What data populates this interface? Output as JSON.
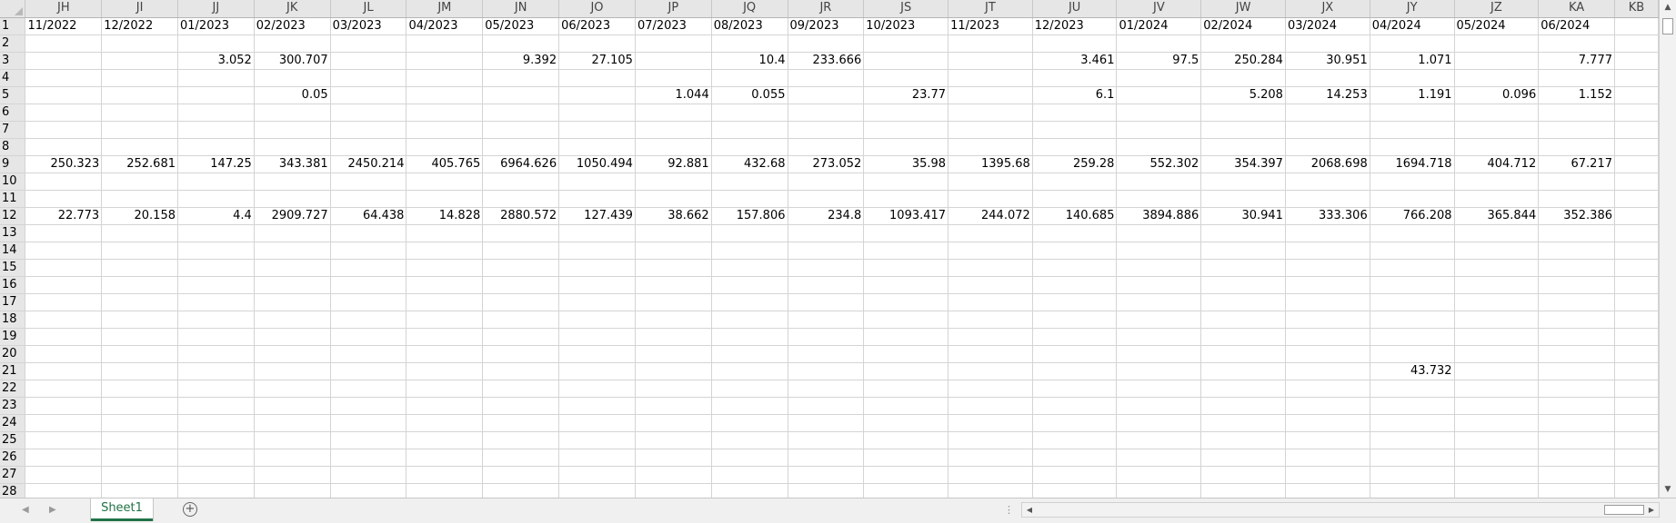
{
  "sheet": {
    "columns": [
      "JH",
      "JI",
      "JJ",
      "JK",
      "JL",
      "JM",
      "JN",
      "JO",
      "JP",
      "JQ",
      "JR",
      "JS",
      "JT",
      "JU",
      "JV",
      "JW",
      "JX",
      "JY",
      "JZ",
      "KA",
      "KB"
    ],
    "col_widths": [
      84,
      84,
      84,
      84,
      84,
      84,
      84,
      84,
      84,
      84,
      84,
      93,
      93,
      93,
      93,
      93,
      93,
      93,
      93,
      84,
      48
    ],
    "rows": [
      {
        "n": "1",
        "cells": [
          "11/2022",
          "12/2022",
          "01/2023",
          "02/2023",
          "03/2023",
          "04/2023",
          "05/2023",
          "06/2023",
          "07/2023",
          "08/2023",
          "09/2023",
          "10/2023",
          "11/2023",
          "12/2023",
          "01/2024",
          "02/2024",
          "03/2024",
          "04/2024",
          "05/2024",
          "06/2024",
          ""
        ]
      },
      {
        "n": "2",
        "cells": []
      },
      {
        "n": "3",
        "cells": [
          "",
          "",
          "3.052",
          "300.707",
          "",
          "",
          "9.392",
          "27.105",
          "",
          "10.4",
          "233.666",
          "",
          "",
          "3.461",
          "97.5",
          "250.284",
          "30.951",
          "1.071",
          "",
          "7.777",
          ""
        ]
      },
      {
        "n": "4",
        "cells": []
      },
      {
        "n": "5",
        "cells": [
          "",
          "",
          "",
          "0.05",
          "",
          "",
          "",
          "",
          "1.044",
          "0.055",
          "",
          "23.77",
          "",
          "6.1",
          "",
          "5.208",
          "14.253",
          "1.191",
          "0.096",
          "1.152",
          ""
        ]
      },
      {
        "n": "6",
        "cells": []
      },
      {
        "n": "7",
        "cells": []
      },
      {
        "n": "8",
        "cells": []
      },
      {
        "n": "9",
        "cells": [
          "250.323",
          "252.681",
          "147.25",
          "343.381",
          "2450.214",
          "405.765",
          "6964.626",
          "1050.494",
          "92.881",
          "432.68",
          "273.052",
          "35.98",
          "1395.68",
          "259.28",
          "552.302",
          "354.397",
          "2068.698",
          "1694.718",
          "404.712",
          "67.217",
          ""
        ]
      },
      {
        "n": "10",
        "cells": []
      },
      {
        "n": "11",
        "cells": []
      },
      {
        "n": "12",
        "cells": [
          "22.773",
          "20.158",
          "4.4",
          "2909.727",
          "64.438",
          "14.828",
          "2880.572",
          "127.439",
          "38.662",
          "157.806",
          "234.8",
          "1093.417",
          "244.072",
          "140.685",
          "3894.886",
          "30.941",
          "333.306",
          "766.208",
          "365.844",
          "352.386",
          ""
        ]
      },
      {
        "n": "13",
        "cells": []
      },
      {
        "n": "14",
        "cells": []
      },
      {
        "n": "15",
        "cells": []
      },
      {
        "n": "16",
        "cells": []
      },
      {
        "n": "17",
        "cells": []
      },
      {
        "n": "18",
        "cells": []
      },
      {
        "n": "19",
        "cells": []
      },
      {
        "n": "20",
        "cells": []
      },
      {
        "n": "21",
        "cells": [
          "",
          "",
          "",
          "",
          "",
          "",
          "",
          "",
          "",
          "",
          "",
          "",
          "",
          "",
          "",
          "",
          "",
          "43.732",
          "",
          "",
          ""
        ]
      },
      {
        "n": "22",
        "cells": []
      },
      {
        "n": "23",
        "cells": []
      },
      {
        "n": "24",
        "cells": []
      },
      {
        "n": "25",
        "cells": []
      },
      {
        "n": "26",
        "cells": []
      },
      {
        "n": "27",
        "cells": []
      },
      {
        "n": "28",
        "cells": []
      }
    ]
  },
  "bottom": {
    "tab_name": "Sheet1",
    "add_sheet": "+",
    "nav_prev": "◀",
    "nav_next": "▶",
    "split_handle": "⋮",
    "scroll_left": "◀",
    "scroll_right": "▶",
    "scroll_up": "▲",
    "scroll_down": "▼"
  },
  "colors": {
    "accent": "#217346",
    "header_bg": "#e6e6e6",
    "grid": "#d4d4d4"
  }
}
